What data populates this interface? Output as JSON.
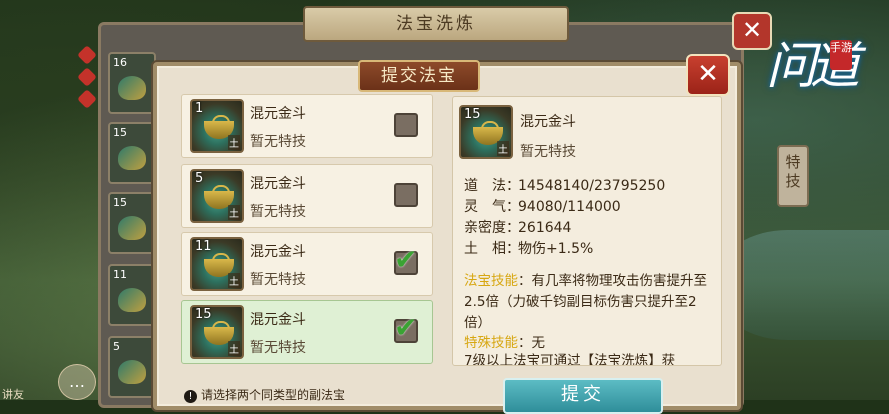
{
  "background_window": {
    "title": "法宝洗炼",
    "close_label": "✕",
    "slots": [
      {
        "level": "16"
      },
      {
        "level": "15"
      },
      {
        "level": "15"
      },
      {
        "level": "11"
      },
      {
        "level": "5"
      }
    ],
    "side_tab": "特技",
    "bottom_left_label": "讲友"
  },
  "logo": {
    "calligraphy": "问道",
    "seal": "手游"
  },
  "dialog": {
    "title": "提交法宝",
    "close_label": "✕",
    "items": [
      {
        "level": "1",
        "element": "土",
        "name": "混元金斗",
        "skill": "暂无特技",
        "checked": false,
        "selected": false
      },
      {
        "level": "5",
        "element": "土",
        "name": "混元金斗",
        "skill": "暂无特技",
        "checked": false,
        "selected": false
      },
      {
        "level": "11",
        "element": "土",
        "name": "混元金斗",
        "skill": "暂无特技",
        "checked": true,
        "selected": false
      },
      {
        "level": "15",
        "element": "土",
        "name": "混元金斗",
        "skill": "暂无特技",
        "checked": true,
        "selected": true
      }
    ],
    "detail": {
      "level": "15",
      "element": "土",
      "name": "混元金斗",
      "skill": "暂无特技",
      "stats": [
        {
          "key": "道　法：",
          "value": "14548140/23795250"
        },
        {
          "key": "灵　气：",
          "value": "94080/114000"
        },
        {
          "key": "亲密度：",
          "value": "261644"
        },
        {
          "key": "土　相：",
          "value": "物伤+1.5%"
        }
      ],
      "skill_label": "法宝技能",
      "skill_text": "：有几率将物理攻击伤害提升至2.5倍（力破千钧副目标伤害只提升至2倍）",
      "special_label": "特殊技能",
      "special_text": "：无",
      "footer_text": "7级以上法宝可通过【法宝洗炼】获"
    },
    "warning": "请选择两个同类型的副法宝",
    "submit_label": "提交"
  }
}
